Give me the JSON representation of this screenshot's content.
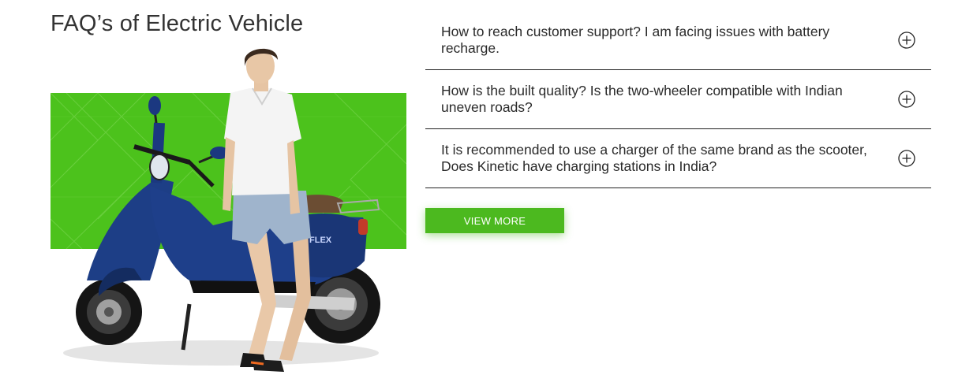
{
  "section": {
    "title": "FAQ’s of Electric Vehicle"
  },
  "hero": {
    "background_color": "#4cc21c",
    "image_subject": "person-seated-on-blue-electric-scooter",
    "scooter_badge": "FLEX"
  },
  "faq": {
    "items": [
      {
        "question": "How to reach customer support? I am facing issues with battery recharge.",
        "icon": "plus-circle-icon"
      },
      {
        "question": "How is the built quality? Is the two-wheeler compatible with Indian uneven roads?",
        "icon": "plus-circle-icon"
      },
      {
        "question": "It is recommended to use a charger of the same brand as the scooter, Does Kinetic have charging stations in India?",
        "icon": "plus-circle-icon"
      }
    ],
    "view_more_label": "VIEW MORE",
    "accent_color": "#4cb91f"
  }
}
